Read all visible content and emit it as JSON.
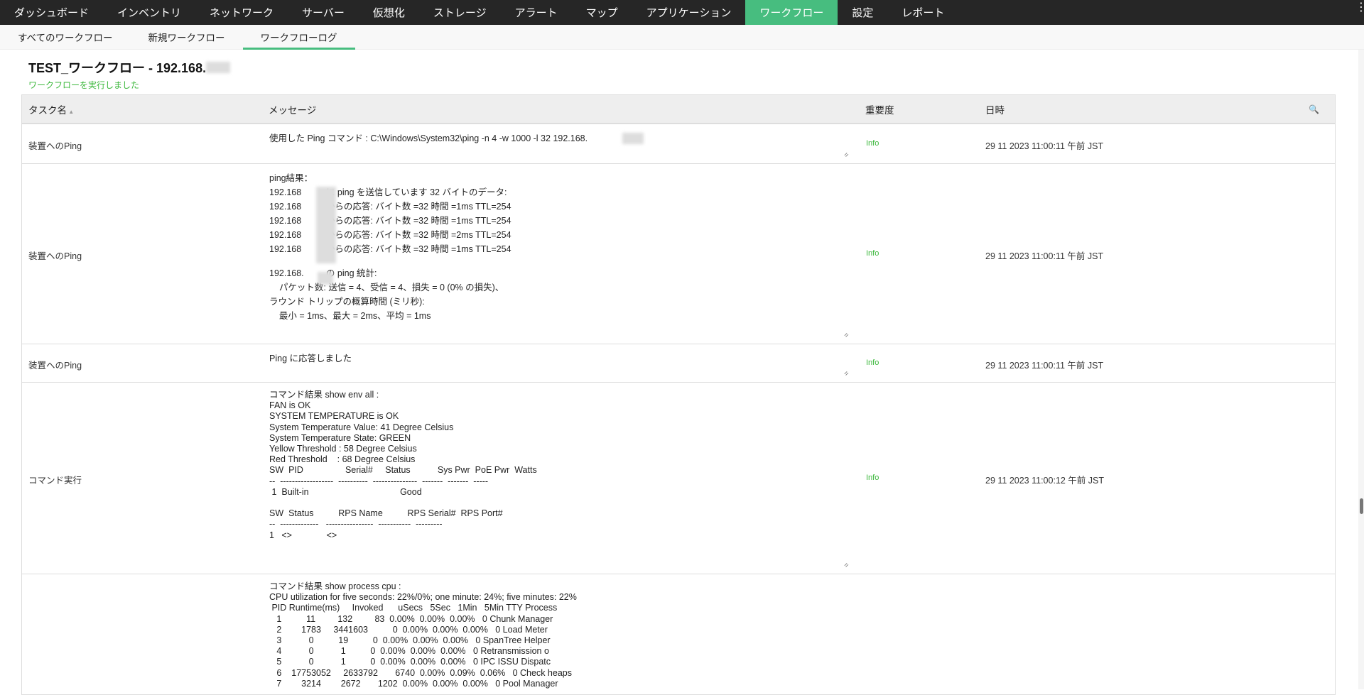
{
  "topnav": {
    "items": [
      "ダッシュボード",
      "インベントリ",
      "ネットワーク",
      "サーバー",
      "仮想化",
      "ストレージ",
      "アラート",
      "マップ",
      "アプリケーション",
      "ワークフロー",
      "設定",
      "レポート"
    ],
    "active": "ワークフロー",
    "more_icon": "⋮"
  },
  "subnav": {
    "tabs": [
      "すべてのワークフロー",
      "新規ワークフロー",
      "ワークフローログ"
    ],
    "active": "ワークフローログ"
  },
  "page": {
    "title": "TEST_ワークフロー - 192.168.",
    "subtitle": "ワークフローを実行しました"
  },
  "table": {
    "headers": {
      "task": "タスク名",
      "message": "メッセージ",
      "severity": "重要度",
      "datetime": "日時"
    },
    "rows": [
      {
        "task": "装置へのPing",
        "severity": "Info",
        "datetime": "29 11 2023 11:00:11 午前 JST",
        "lines": [
          "使用した Ping コマンド : C:\\Windows\\System32\\ping -n 4 -w 1000 -l 32 192.168."
        ]
      },
      {
        "task": "装置へのPing",
        "severity": "Info",
        "datetime": "29 11 2023 11:00:11 午前 JST",
        "lines": [
          "ping結果：",
          "192.168          に ping を送信しています 32 バイトのデータ:",
          "192.168          からの応答: バイト数 =32 時間 =1ms TTL=254",
          "192.168          からの応答: バイト数 =32 時間 =1ms TTL=254",
          "192.168          からの応答: バイト数 =32 時間 =2ms TTL=254",
          "192.168          からの応答: バイト数 =32 時間 =1ms TTL=254",
          "",
          "192.168.         の ping 統計:",
          "    パケット数: 送信 = 4、受信 = 4、損失 = 0 (0% の損失)、",
          "ラウンド トリップの概算時間 (ミリ秒):",
          "    最小 = 1ms、最大 = 2ms、平均 = 1ms"
        ]
      },
      {
        "task": "装置へのPing",
        "severity": "Info",
        "datetime": "29 11 2023 11:00:11 午前 JST",
        "lines": [
          "Ping に応答しました"
        ]
      },
      {
        "task": "コマンド実行",
        "severity": "Info",
        "datetime": "29 11 2023 11:00:12 午前 JST",
        "lines": [
          "コマンド結果 show env all :",
          "FAN is OK",
          "SYSTEM TEMPERATURE is OK",
          "System Temperature Value: 41 Degree Celsius",
          "System Temperature State: GREEN",
          "Yellow Threshold : 58 Degree Celsius",
          "Red Threshold    : 68 Degree Celsius",
          "SW  PID                 Serial#     Status           Sys Pwr  PoE Pwr  Watts",
          "--  ------------------  ----------  ---------------  -------  -------  -----",
          " 1  Built-in                                     Good",
          "",
          "SW  Status          RPS Name          RPS Serial#  RPS Port#",
          "--  -------------   ----------------  -----------  ---------",
          "1   <>              <>"
        ]
      },
      {
        "task": "",
        "severity": "",
        "datetime": "",
        "lines": [
          "コマンド結果 show process cpu :",
          "CPU utilization for five seconds: 22%/0%; one minute: 24%; five minutes: 22%",
          " PID Runtime(ms)     Invoked      uSecs   5Sec   1Min   5Min TTY Process",
          "   1          11         132         83  0.00%  0.00%  0.00%   0 Chunk Manager",
          "   2        1783     3441603          0  0.00%  0.00%  0.00%   0 Load Meter",
          "   3           0          19          0  0.00%  0.00%  0.00%   0 SpanTree Helper",
          "   4           0           1          0  0.00%  0.00%  0.00%   0 Retransmission o",
          "   5           0           1          0  0.00%  0.00%  0.00%   0 IPC ISSU Dispatc",
          "   6    17753052     2633792       6740  0.00%  0.09%  0.06%   0 Check heaps",
          "   7        3214        2672       1202  0.00%  0.00%  0.00%   0 Pool Manager"
        ]
      }
    ]
  },
  "colors": {
    "accent": "#47bd7f",
    "info": "#3db83d",
    "nav_bg": "#262626"
  }
}
